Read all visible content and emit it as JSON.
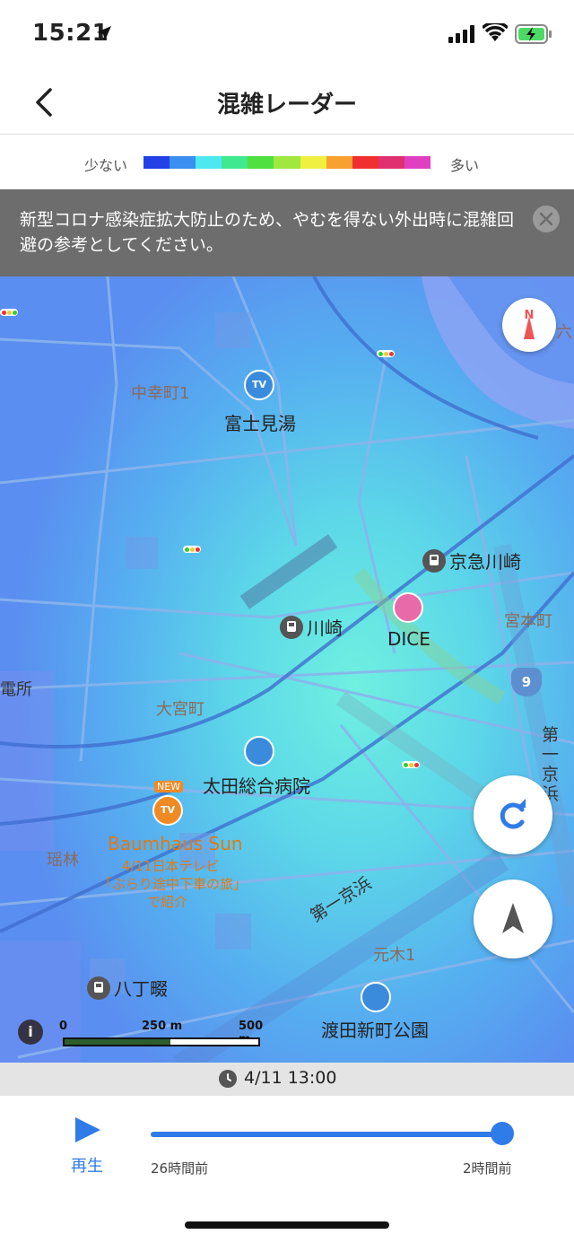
{
  "status_bar": {
    "time": "15:21"
  },
  "header": {
    "title": "混雑レーダー"
  },
  "legend": {
    "low_label": "少ない",
    "high_label": "多い",
    "colors": [
      "#2340e6",
      "#3a8ff0",
      "#4ee8f0",
      "#40e890",
      "#50e040",
      "#a0e840",
      "#f0f040",
      "#f8a030",
      "#f03030",
      "#e03070",
      "#e040c0"
    ]
  },
  "notice": {
    "text": "新型コロナ感染症拡大防止のため、やむを得ない外出時に混雑回避の参考としてください。"
  },
  "map": {
    "labels": {
      "nakasaiwai": "中幸町1",
      "fujimiyu": "富士見湯",
      "keikyu_kawasaki": "京急川崎",
      "miyamoto": "宮本町",
      "kawasaki": "川崎",
      "dice": "DICE",
      "omiya": "大宮町",
      "denjo": "電所",
      "ota_hospital": "太田総合病院",
      "baumhaus": "Baumhaus Sun",
      "baumhaus_note1": "4/11日本テレビ",
      "baumhaus_note2": "「ぶらり途中下車の旅」",
      "baumhaus_note3": "で紹介",
      "new_badge": "NEW",
      "tv_badge": "TV",
      "daiichi_keihin": "第一京浜",
      "daiichi_keihin_v": "第一京浜",
      "motoki": "元木1",
      "hatchonawate": "八丁畷",
      "watarida_park": "渡田新町公園",
      "roku": "六",
      "suzumi": "瑶林",
      "route_number": "9",
      "compass_letter": "N"
    },
    "scale": {
      "zero": "0",
      "mid": "250 m",
      "max": "500 m"
    },
    "info_symbol": "i"
  },
  "time_display": "4/11 13:00",
  "player": {
    "play_label": "再生",
    "range_start": "26時間前",
    "range_end": "2時間前",
    "position_fraction": 1.0
  }
}
